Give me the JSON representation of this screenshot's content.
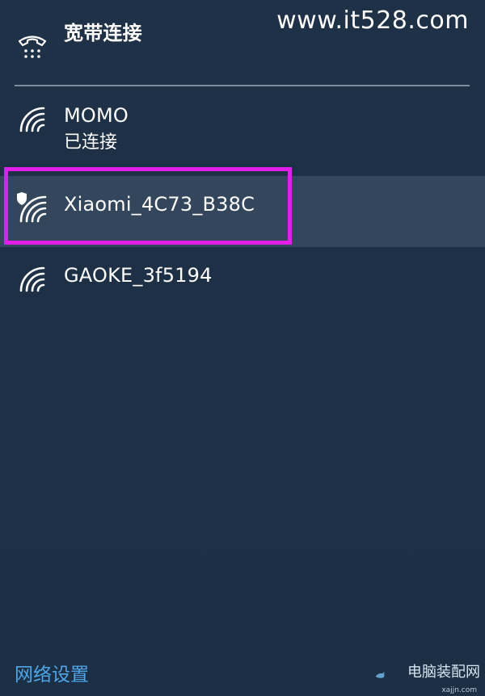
{
  "watermark": {
    "text": "www.it528.com"
  },
  "broadband": {
    "label": "宽带连接",
    "icon": "dialup-phone-icon"
  },
  "networks": [
    {
      "name": "MOMO",
      "status": "已连接",
      "icon": "wifi-icon",
      "selected": false,
      "secured": false
    },
    {
      "name": "Xiaomi_4C73_B38C",
      "status": "",
      "icon": "wifi-shield-icon",
      "selected": true,
      "secured": true
    },
    {
      "name": "GAOKE_3f5194",
      "status": "",
      "icon": "wifi-icon",
      "selected": false,
      "secured": false
    }
  ],
  "footer": {
    "settings_link": "网络设置"
  },
  "corner_logo": {
    "text": "电脑装配网",
    "subtext": "xajjn.com"
  },
  "colors": {
    "background": "#1e3046",
    "selected_row": "#34465b",
    "highlight_border": "#e31ee8",
    "link": "#4da6e8",
    "divider": "#7d8c9e"
  }
}
